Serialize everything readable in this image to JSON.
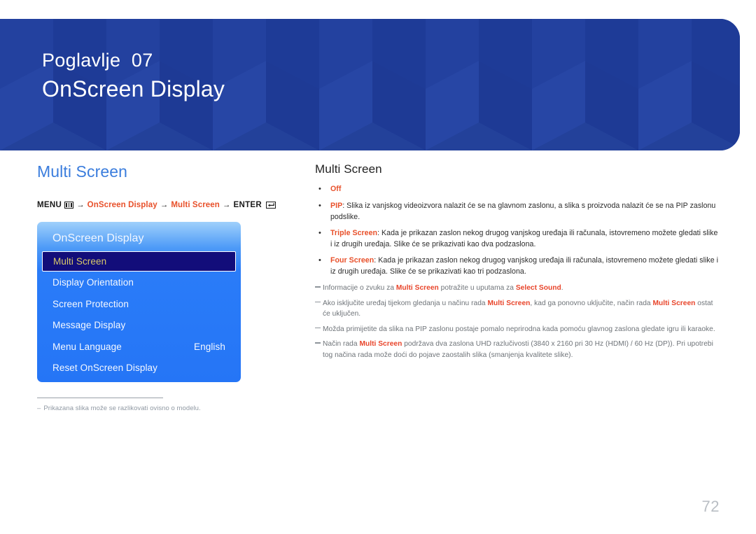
{
  "banner": {
    "chapter": "Poglavlje  07",
    "title": "OnScreen Display",
    "bg_color": "#213f9e"
  },
  "left": {
    "heading": "Multi Screen",
    "heading_color": "#3b7ddd",
    "breadcrumb": {
      "menu_label": "MENU",
      "menu_icon": "menu-grid-icon",
      "arrow": "→",
      "step1": "OnScreen Display",
      "step2": "Multi Screen",
      "enter_label": "ENTER",
      "enter_icon": "enter-return-icon",
      "link_color": "#e8502a"
    },
    "osd": {
      "title": "OnScreen Display",
      "items": [
        {
          "label": "Multi Screen",
          "value": "",
          "selected": true
        },
        {
          "label": "Display Orientation",
          "value": "",
          "selected": false
        },
        {
          "label": "Screen Protection",
          "value": "",
          "selected": false
        },
        {
          "label": "Message Display",
          "value": "",
          "selected": false
        },
        {
          "label": "Menu Language",
          "value": "English",
          "selected": false
        },
        {
          "label": "Reset OnScreen Display",
          "value": "",
          "selected": false
        }
      ],
      "selected_bg": "#120d7a",
      "selected_text_color": "#d9c96a"
    },
    "footnote": {
      "dash": "–",
      "text": "Prikazana slika može se razlikovati ovisno o modelu."
    }
  },
  "right": {
    "heading": "Multi Screen",
    "bullets": [
      {
        "term": "Off",
        "rest": ""
      },
      {
        "term": "PIP",
        "rest": ": Slika iz vanjskog videoizvora nalazit će se na glavnom zaslonu, a slika s proizvoda nalazit će se na PIP zaslonu podslike."
      },
      {
        "term": "Triple Screen",
        "rest": ": Kada je prikazan zaslon nekog drugog vanjskog uređaja ili računala, istovremeno možete gledati slike i iz drugih uređaja. Slike će se prikazivati kao dva podzaslona."
      },
      {
        "term": "Four Screen",
        "rest": ": Kada je prikazan zaslon nekog drugog vanjskog uređaja ili računala, istovremeno možete gledati slike i iz drugih uređaja. Slike će se prikazivati kao tri podzaslona."
      }
    ],
    "notes": [
      {
        "parts": [
          {
            "t": "Informacije o zvuku za ",
            "hl": false
          },
          {
            "t": "Multi Screen",
            "hl": true
          },
          {
            "t": " potražite u uputama za ",
            "hl": false
          },
          {
            "t": "Select Sound",
            "hl": true
          },
          {
            "t": ".",
            "hl": false
          }
        ]
      },
      {
        "parts": [
          {
            "t": "Ako isključite uređaj tijekom gledanja u načinu rada ",
            "hl": false
          },
          {
            "t": "Multi Screen",
            "hl": true
          },
          {
            "t": ", kad ga ponovno uključite, način rada ",
            "hl": false
          },
          {
            "t": "Multi Screen",
            "hl": true
          },
          {
            "t": " ostat će uključen.",
            "hl": false
          }
        ]
      },
      {
        "parts": [
          {
            "t": "Možda primijetite da slika na PIP zaslonu postaje pomalo neprirodna kada pomoću glavnog zaslona gledate igru ili karaoke.",
            "hl": false
          }
        ]
      },
      {
        "parts": [
          {
            "t": "Način rada ",
            "hl": false
          },
          {
            "t": "Multi Screen",
            "hl": true
          },
          {
            "t": " podržava dva zaslona UHD razlučivosti (3840 x 2160 pri 30 Hz (HDMI) / 60 Hz (DP)). Pri upotrebi tog načina rada može doći do pojave zaostalih slika (smanjenja kvalitete slike).",
            "hl": false
          }
        ]
      }
    ]
  },
  "page_number": "72"
}
